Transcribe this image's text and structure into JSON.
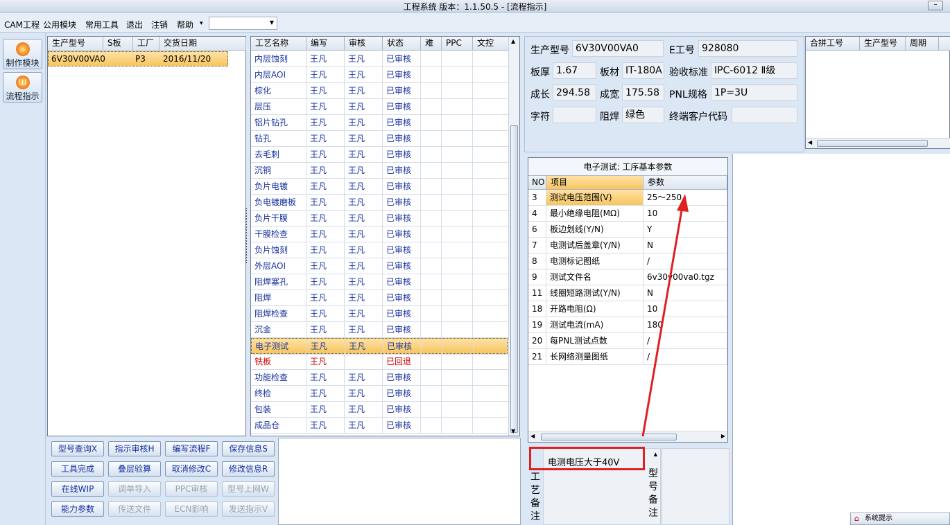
{
  "window": {
    "title": "工程系统   版本：1.1.50.5 - [流程指示]"
  },
  "menu": {
    "items": [
      "CAM工程",
      "公用模块",
      "常用工具",
      "退出",
      "注销",
      "帮助"
    ],
    "help_arrow": "▾",
    "combo_value": ""
  },
  "leftbar": {
    "buttons": [
      {
        "label": "制作模块",
        "icon": "flame-icon"
      },
      {
        "label": "流程指示",
        "icon": "flow-icon"
      }
    ]
  },
  "order_table": {
    "headers": [
      "生产型号",
      "S板",
      "工厂",
      "交货日期"
    ],
    "rows": [
      [
        "6V30V00VA0",
        "",
        "P3",
        "2016/11/20"
      ]
    ]
  },
  "process_table": {
    "headers": [
      "工艺名称",
      "编写",
      "审核",
      "状态",
      "难",
      "PPC",
      "文控"
    ],
    "selected_index": 18,
    "rows": [
      [
        "内层蚀刻",
        "王凡",
        "王凡",
        "已审核"
      ],
      [
        "内层AOI",
        "王凡",
        "王凡",
        "已审核"
      ],
      [
        "棕化",
        "王凡",
        "王凡",
        "已审核"
      ],
      [
        "层压",
        "王凡",
        "王凡",
        "已审核"
      ],
      [
        "铝片钻孔",
        "王凡",
        "王凡",
        "已审核"
      ],
      [
        "钻孔",
        "王凡",
        "王凡",
        "已审核"
      ],
      [
        "去毛刺",
        "王凡",
        "王凡",
        "已审核"
      ],
      [
        "沉铜",
        "王凡",
        "王凡",
        "已审核"
      ],
      [
        "负片电镀",
        "王凡",
        "王凡",
        "已审核"
      ],
      [
        "负电镀磨板",
        "王凡",
        "王凡",
        "已审核"
      ],
      [
        "负片干膜",
        "王凡",
        "王凡",
        "已审核"
      ],
      [
        "干膜检查",
        "王凡",
        "王凡",
        "已审核"
      ],
      [
        "负片蚀刻",
        "王凡",
        "王凡",
        "已审核"
      ],
      [
        "外层AOI",
        "王凡",
        "王凡",
        "已审核"
      ],
      [
        "阻焊塞孔",
        "王凡",
        "王凡",
        "已审核"
      ],
      [
        "阻焊",
        "王凡",
        "王凡",
        "已审核"
      ],
      [
        "阻焊检查",
        "王凡",
        "王凡",
        "已审核"
      ],
      [
        "沉金",
        "王凡",
        "王凡",
        "已审核"
      ],
      [
        "电子测试",
        "王凡",
        "王凡",
        "已审核"
      ],
      [
        "铣板",
        "王凡",
        "",
        "已回退"
      ],
      [
        "功能检查",
        "王凡",
        "王凡",
        "已审核"
      ],
      [
        "终检",
        "王凡",
        "王凡",
        "已审核"
      ],
      [
        "包装",
        "王凡",
        "王凡",
        "已审核"
      ],
      [
        "成品仓",
        "王凡",
        "王凡",
        "已审核"
      ]
    ]
  },
  "actions": {
    "buttons": [
      {
        "label": "型号查询X",
        "enabled": true
      },
      {
        "label": "指示审核H",
        "enabled": true
      },
      {
        "label": "编写流程F",
        "enabled": true
      },
      {
        "label": "保存信息S",
        "enabled": true
      },
      {
        "label": "工具完成",
        "enabled": true
      },
      {
        "label": "叠层验算",
        "enabled": true
      },
      {
        "label": "取消修改C",
        "enabled": true
      },
      {
        "label": "修改信息R",
        "enabled": true
      },
      {
        "label": "在线WIP",
        "enabled": true
      },
      {
        "label": "调单导入",
        "enabled": false
      },
      {
        "label": "PPC审核",
        "enabled": false
      },
      {
        "label": "型号上网W",
        "enabled": false
      },
      {
        "label": "能力参数",
        "enabled": true
      },
      {
        "label": "传送文件",
        "enabled": false
      },
      {
        "label": "ECN影响",
        "enabled": false
      },
      {
        "label": "发送指示V",
        "enabled": false
      }
    ]
  },
  "info": {
    "model_label": "生产型号",
    "model": "6V30V00VA0",
    "e_label": "E工号",
    "e_no": "928080",
    "thick_label": "板厚",
    "thick": "1.67",
    "mat_label": "板材",
    "mat": "IT-180A",
    "std_label": "验收标准",
    "std": "IPC-6012 Ⅱ级",
    "len_label": "成长",
    "len": "294.58",
    "wid_label": "成宽",
    "wid": "175.58",
    "pnl_label": "PNL规格",
    "pnl": "1P=3U",
    "char_label": "字符",
    "char": "",
    "mask_label": "阻焊",
    "mask": "绿色",
    "cust_label": "终端客户代码",
    "cust": ""
  },
  "merge_table": {
    "headers": [
      "合拼工号",
      "生产型号",
      "周期"
    ]
  },
  "param_panel": {
    "title": "电子测试: 工序基本参数",
    "headers": [
      "NO",
      "项目",
      "参数"
    ],
    "selected_index": 0,
    "rows": [
      [
        "3",
        "测试电压范围(V)",
        "25～250"
      ],
      [
        "4",
        "最小绝缘电阻(MΩ)",
        "10"
      ],
      [
        "6",
        "板边划线(Y/N)",
        "Y"
      ],
      [
        "7",
        "电测试后盖章(Y/N)",
        "N"
      ],
      [
        "8",
        "电测标记图纸",
        "/"
      ],
      [
        "9",
        "测试文件名",
        "6v30v00va0.tgz"
      ],
      [
        "11",
        "线圈短路测试(Y/N)",
        "N"
      ],
      [
        "18",
        "开路电阻(Ω)",
        "10"
      ],
      [
        "19",
        "测试电流(mA)",
        "180"
      ],
      [
        "20",
        "每PNL测试点数",
        "/"
      ],
      [
        "21",
        "长网络测量图纸",
        "/"
      ]
    ]
  },
  "notes": {
    "process_label": "工艺备注",
    "process_note": "电测电压大于40V",
    "model_label": "型号备注",
    "model_note": ""
  },
  "status": {
    "tip": "系统提示"
  }
}
